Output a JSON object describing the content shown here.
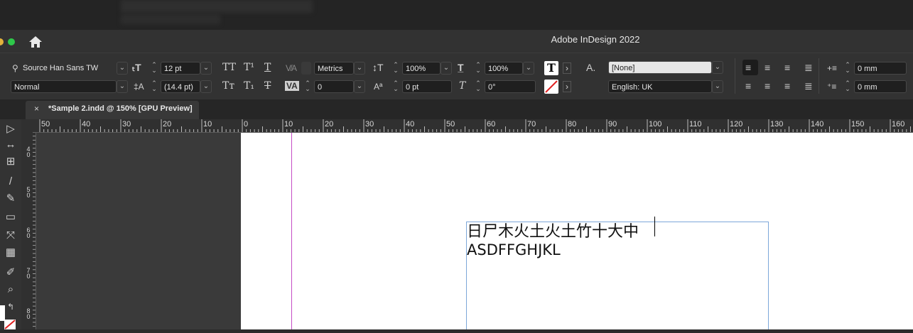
{
  "app": {
    "title": "Adobe InDesign 2022"
  },
  "control_panel": {
    "font_family": "Source Han Sans TW",
    "font_style": "Normal",
    "font_size": "12 pt",
    "leading": "(14.4 pt)",
    "kerning": "Metrics",
    "tracking": "0",
    "vertical_scale": "100%",
    "horizontal_scale": "100%",
    "baseline_shift": "0 pt",
    "skew": "0°",
    "char_style": "[None]",
    "language": "English: UK",
    "left_indent": "0 mm",
    "first_line_indent": "0 mm",
    "caps_all": "TT",
    "superscript": "T¹",
    "underline": "T",
    "small_caps": "Tт",
    "subscript": "T₁",
    "strikethrough": "T",
    "char_style_icon": "A.",
    "fill_label": "T"
  },
  "tab": {
    "close": "×",
    "title": "*Sample 2.indd @ 150% [GPU Preview]"
  },
  "ruler": {
    "h_labels": [
      "50",
      "40",
      "30",
      "20",
      "10",
      "0",
      "10",
      "20",
      "30",
      "40",
      "50",
      "60",
      "70",
      "80",
      "90",
      "100",
      "110",
      "120",
      "130",
      "140",
      "150",
      "160"
    ],
    "v_labels": [
      [
        "4",
        "0"
      ],
      [
        "5",
        "0"
      ],
      [
        "6",
        "0"
      ],
      [
        "7",
        "0"
      ],
      [
        "8",
        "0"
      ]
    ]
  },
  "document": {
    "line1": "日尸木火土火土竹十大中",
    "line2": "ASDFFGHJKL"
  },
  "colors": {
    "accent_guide": "#c44bc4",
    "frame": "#7da7d9",
    "green": "#2ec84a"
  }
}
